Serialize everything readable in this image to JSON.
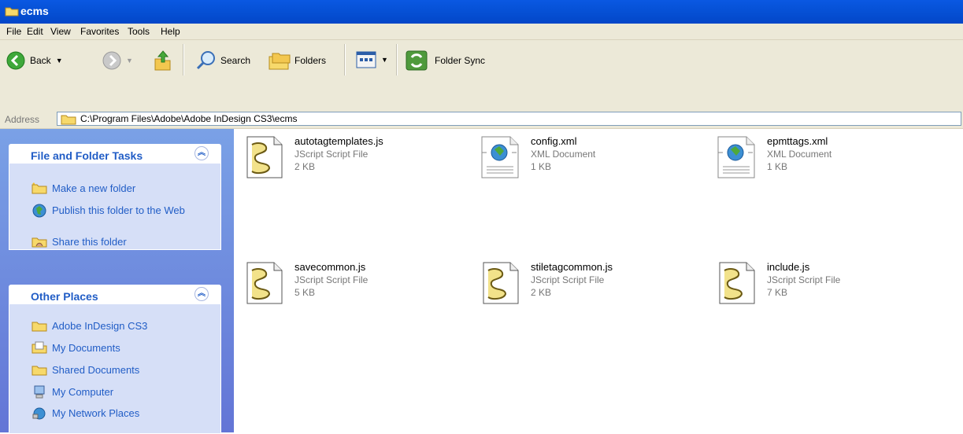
{
  "window": {
    "title": "ecms"
  },
  "menu": [
    "File",
    "Edit",
    "View",
    "Favorites",
    "Tools",
    "Help"
  ],
  "toolbar": {
    "back_label": "Back",
    "search_label": "Search",
    "folders_label": "Folders",
    "folder_sync_label": "Folder Sync"
  },
  "address": {
    "label": "Address",
    "value": "C:\\Program Files\\Adobe\\Adobe InDesign CS3\\ecms"
  },
  "left_pane": {
    "file_folder_tasks": {
      "title": "File and Folder Tasks",
      "items": [
        {
          "label": "Make a new folder",
          "icon": "new-folder-icon"
        },
        {
          "label": "Publish this folder to the Web",
          "icon": "publish-web-icon"
        },
        {
          "label": "Share this folder",
          "icon": "share-folder-icon"
        }
      ]
    },
    "other_places": {
      "title": "Other Places",
      "items": [
        {
          "label": "Adobe InDesign CS3",
          "icon": "folder-icon"
        },
        {
          "label": "My Documents",
          "icon": "my-documents-icon"
        },
        {
          "label": "Shared Documents",
          "icon": "folder-icon"
        },
        {
          "label": "My Computer",
          "icon": "my-computer-icon"
        },
        {
          "label": "My Network Places",
          "icon": "network-places-icon"
        }
      ]
    }
  },
  "files": [
    {
      "name": "autotagtemplates.js",
      "type": "JScript Script File",
      "size": "2 KB",
      "icon": "jscript-file-icon"
    },
    {
      "name": "config.xml",
      "type": "XML Document",
      "size": "1 KB",
      "icon": "xml-file-icon"
    },
    {
      "name": "epmttags.xml",
      "type": "XML Document",
      "size": "1 KB",
      "icon": "xml-file-icon"
    },
    {
      "name": "savecommon.js",
      "type": "JScript Script File",
      "size": "5 KB",
      "icon": "jscript-file-icon"
    },
    {
      "name": "stiletagcommon.js",
      "type": "JScript Script File",
      "size": "2 KB",
      "icon": "jscript-file-icon"
    },
    {
      "name": "include.js",
      "type": "JScript Script File",
      "size": "7 KB",
      "icon": "jscript-file-icon"
    }
  ],
  "colors": {
    "titlebar": "#0651d6",
    "chrome": "#ece9d8",
    "taskpane_gradient_top": "#7aa1e6",
    "taskpane_gradient_bottom": "#6375d6",
    "task_link": "#215dc6"
  }
}
